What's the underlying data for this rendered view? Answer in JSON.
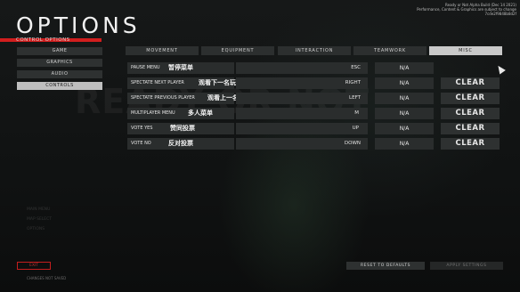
{
  "header": {
    "title": "OPTIONS",
    "subtitle": "CONTROL OPTIONS",
    "version_lines": [
      "Ready or Not Alpha Build (Dec 14 2021)",
      "Performance, Content & Graphics are subject to change",
      "7cde2f9848b8d2f"
    ]
  },
  "background_text": "READY OR NOT",
  "sidebar": {
    "items": [
      {
        "label": "GAME",
        "active": false
      },
      {
        "label": "GRAPHICS",
        "active": false
      },
      {
        "label": "AUDIO",
        "active": false
      },
      {
        "label": "CONTROLS",
        "active": true
      }
    ],
    "ghost_items": [
      "MAIN MENU",
      "MAP SELECT",
      "OPTIONS"
    ]
  },
  "tabs": [
    {
      "label": "MOVEMENT",
      "active": false
    },
    {
      "label": "EQUIPMENT",
      "active": false
    },
    {
      "label": "INTERACTION",
      "active": false
    },
    {
      "label": "TEAMWORK",
      "active": false
    },
    {
      "label": "MISC",
      "active": true
    }
  ],
  "bindings": [
    {
      "action": "PAUSE MENU",
      "action_cn": "暂停菜单",
      "primary": "Esc",
      "secondary": "N/A",
      "clear": ""
    },
    {
      "action": "SPECTATE NEXT PLAYER",
      "action_cn": "观看下一名玩家",
      "primary": "Right",
      "secondary": "N/A",
      "clear": "CLEAR"
    },
    {
      "action": "SPECTATE PREVIOUS PLAYER",
      "action_cn": "观看上一名玩家",
      "primary": "Left",
      "secondary": "N/A",
      "clear": "CLEAR"
    },
    {
      "action": "MULTIPLAYER MENU",
      "action_cn": "多人菜单",
      "primary": "M",
      "secondary": "N/A",
      "clear": "CLEAR"
    },
    {
      "action": "VOTE YES",
      "action_cn": "赞同投票",
      "primary": "Up",
      "secondary": "N/A",
      "clear": "CLEAR"
    },
    {
      "action": "VOTE NO",
      "action_cn": "反对投票",
      "primary": "Down",
      "secondary": "N/A",
      "clear": "CLEAR"
    }
  ],
  "footer": {
    "exit_label": "EXIT",
    "exit_note": "CHANGES NOT SAVED",
    "reset_label": "RESET TO DEFAULTS",
    "apply_label": "APPLY SETTINGS"
  },
  "colors": {
    "accent": "#d21e1e",
    "panel": "#2a2d2d",
    "active_tab": "#c9c9c9"
  },
  "icons": {
    "cursor": "mouse-pointer-icon"
  }
}
